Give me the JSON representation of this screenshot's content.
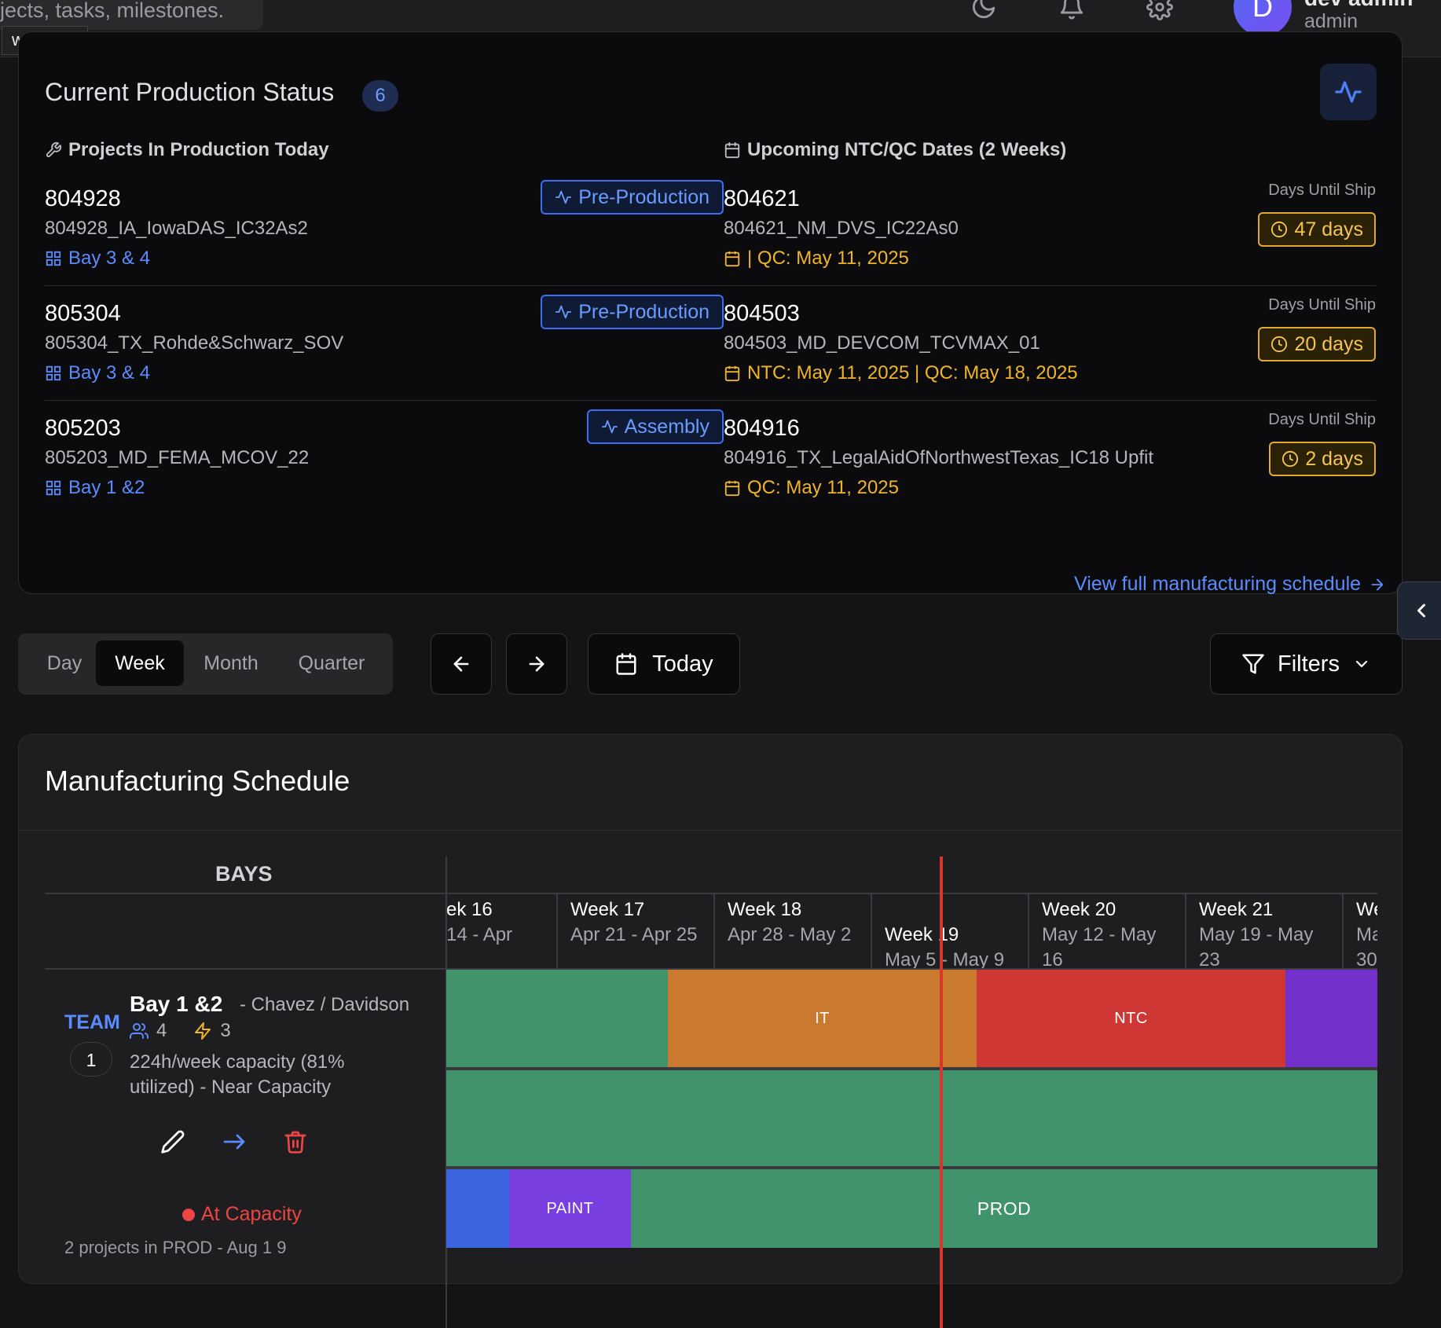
{
  "topbar": {
    "search_text": "jects, tasks, milestones.",
    "webview_label": "webview",
    "user": {
      "initial": "D",
      "name": "dev admin",
      "role": "admin"
    }
  },
  "production_status": {
    "title": "Current Production Status",
    "count": "6",
    "in_production_heading": "Projects In Production Today",
    "upcoming_heading": "Upcoming NTC/QC Dates (2 Weeks)",
    "projects": [
      {
        "number": "804928",
        "name": "804928_IA_IowaDAS_IC32As2",
        "bay": "Bay 3 & 4",
        "stage": "Pre-Production"
      },
      {
        "number": "805304",
        "name": "805304_TX_Rohde&Schwarz_SOV",
        "bay": "Bay 3 & 4",
        "stage": "Pre-Production"
      },
      {
        "number": "805203",
        "name": "805203_MD_FEMA_MCOV_22",
        "bay": "Bay 1 &2",
        "stage": "Assembly"
      }
    ],
    "upcoming": [
      {
        "number": "804621",
        "name": "804621_NM_DVS_IC22As0",
        "dates": "| QC: May 11, 2025",
        "days_label": "Days Until Ship",
        "days": "47 days"
      },
      {
        "number": "804503",
        "name": "804503_MD_DEVCOM_TCVMAX_01",
        "dates": "NTC: May 11, 2025 | QC: May 18, 2025",
        "days_label": "Days Until Ship",
        "days": "20 days"
      },
      {
        "number": "804916",
        "name": "804916_TX_LegalAidOfNorthwestTexas_IC18 Upfit",
        "dates": "QC: May 11, 2025",
        "days_label": "Days Until Ship",
        "days": "2 days"
      }
    ],
    "view_full_link": "View full manufacturing schedule"
  },
  "toolbar": {
    "views": [
      "Day",
      "Week",
      "Month",
      "Quarter"
    ],
    "active_view": "Week",
    "today_label": "Today",
    "filters_label": "Filters"
  },
  "schedule": {
    "title": "Manufacturing Schedule",
    "bays_header": "BAYS",
    "weeks": [
      {
        "title": "ek 16",
        "dates": "14 - Apr"
      },
      {
        "title": "Week 17",
        "dates": "Apr 21 - Apr 25"
      },
      {
        "title": "Week 18",
        "dates": "Apr 28 - May 2"
      },
      {
        "title": "Week 19",
        "dates": "May 5 - May 9"
      },
      {
        "title": "Week 20",
        "dates": "May 12 - May 16"
      },
      {
        "title": "Week 21",
        "dates": "May 19 - May 23"
      },
      {
        "title": "We",
        "dates": "Ma 30"
      }
    ],
    "bay": {
      "team_label": "TEAM",
      "team_number": "1",
      "name": "Bay 1 &2",
      "managers": "- Chavez / Davidson",
      "staff_count": "4",
      "electrical_count": "3",
      "capacity_text": "224h/week capacity (81% utilized) - Near Capacity",
      "status": "At Capacity",
      "prod_summary": "2 projects in PROD - Aug 1 9"
    },
    "lanes": [
      {
        "blocks": [
          {
            "label": "",
            "color": "#40936a"
          },
          {
            "label": "IT",
            "color": "#c97a2e"
          },
          {
            "label": "NTC",
            "color": "#ce3733"
          },
          {
            "label": "",
            "color": "#7330cb"
          }
        ]
      },
      {
        "blocks": [
          {
            "label": "",
            "color": "#40936a"
          }
        ]
      },
      {
        "blocks": [
          {
            "label": "",
            "color": "#3d65e0"
          },
          {
            "label": "PAINT",
            "color": "#7a3fe0"
          },
          {
            "label": "PROD",
            "color": "#40936a"
          }
        ]
      }
    ]
  }
}
